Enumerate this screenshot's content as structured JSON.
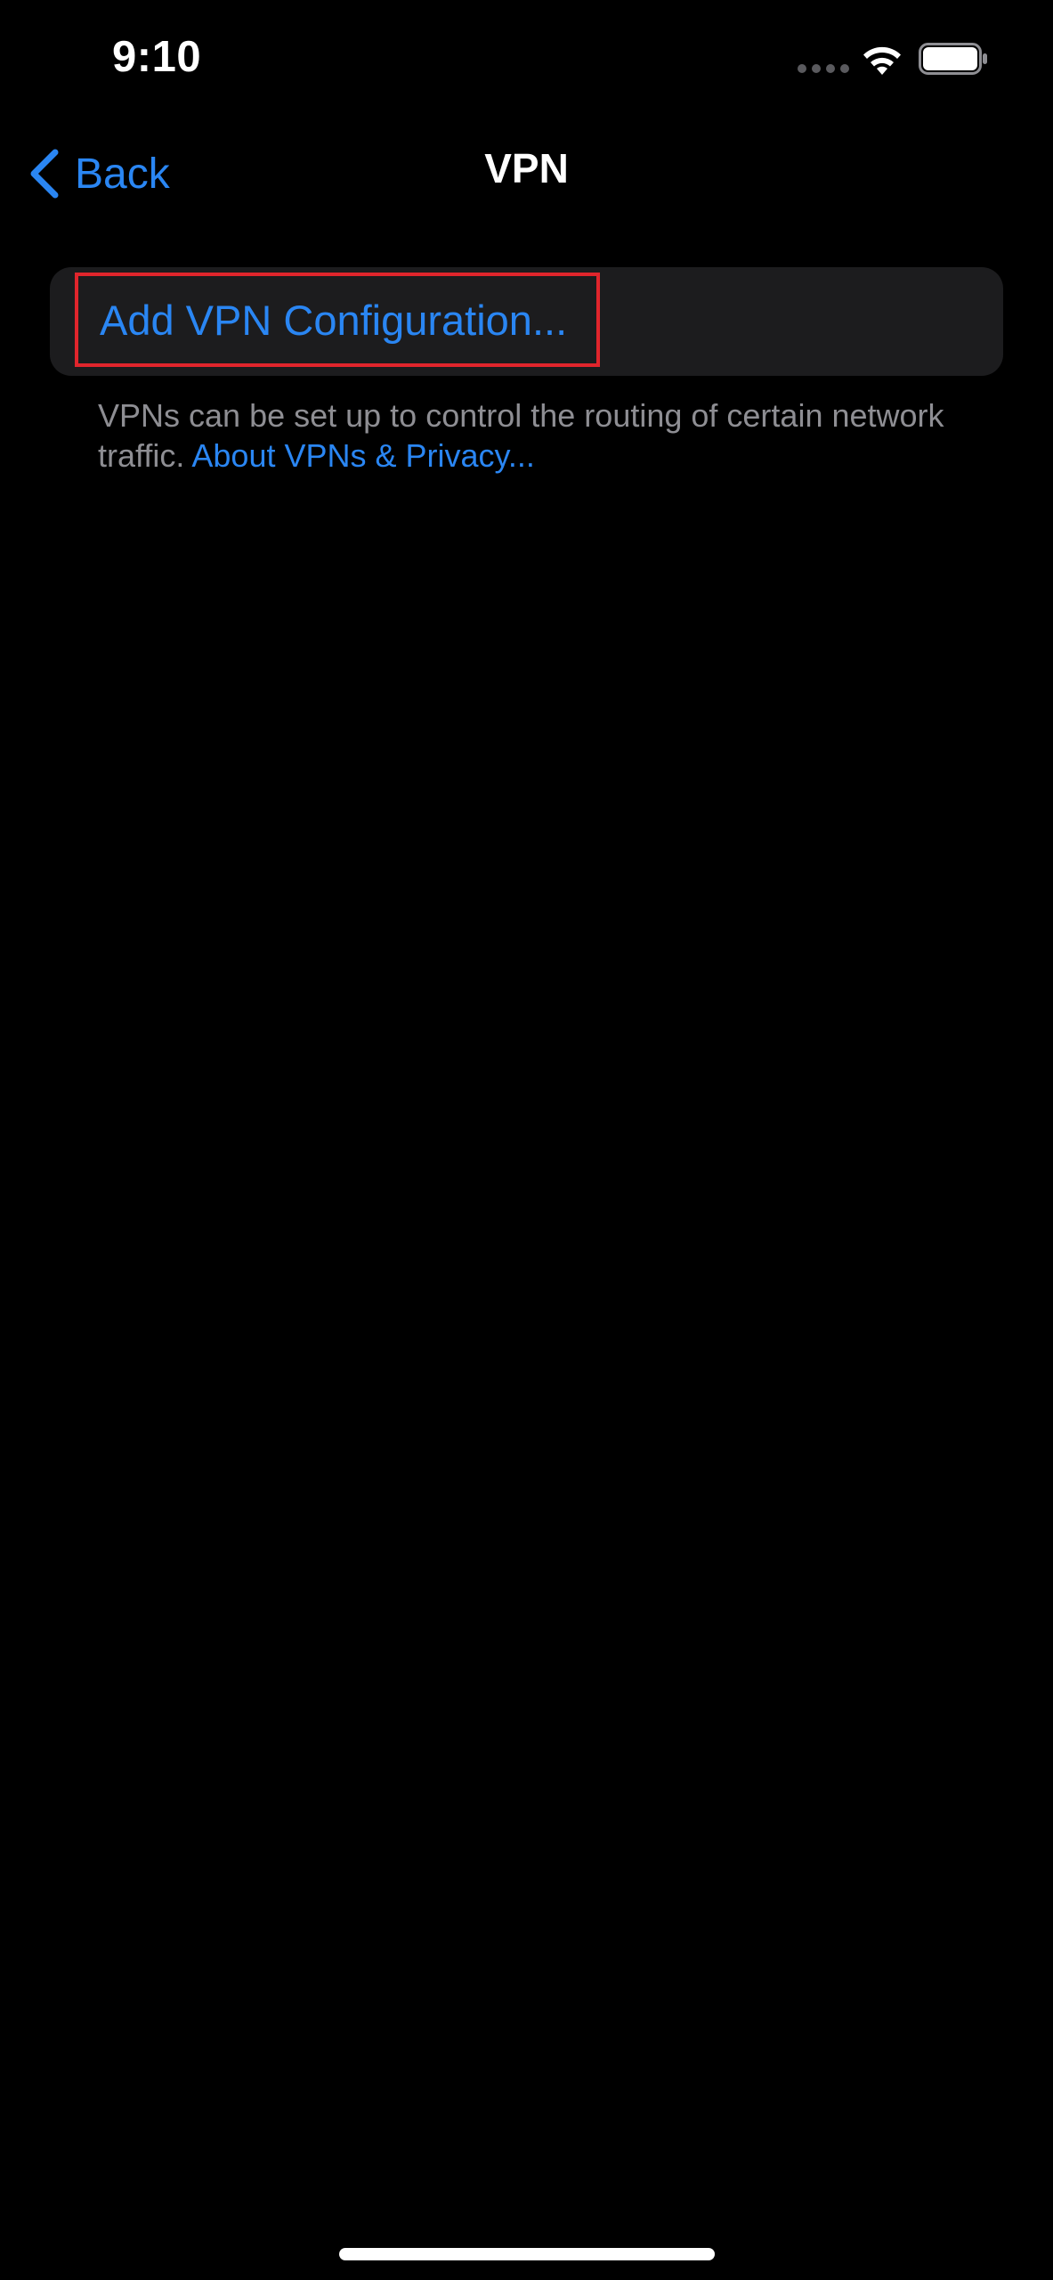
{
  "status_bar": {
    "time": "9:10",
    "signal_icon": "cellular-signal-dots-icon",
    "wifi_icon": "wifi-icon",
    "battery_icon": "battery-full-icon"
  },
  "nav": {
    "back_label": "Back",
    "title": "VPN"
  },
  "vpn_group": {
    "add_label": "Add VPN Configuration..."
  },
  "footer": {
    "text": "VPNs can be set up to control the routing of certain network traffic.",
    "link": "About VPNs & Privacy..."
  },
  "colors": {
    "background": "#000000",
    "group_background": "#1c1c1e",
    "accent": "#2a86f3",
    "highlight": "#e0252c",
    "secondary_text": "#8e8e93"
  }
}
